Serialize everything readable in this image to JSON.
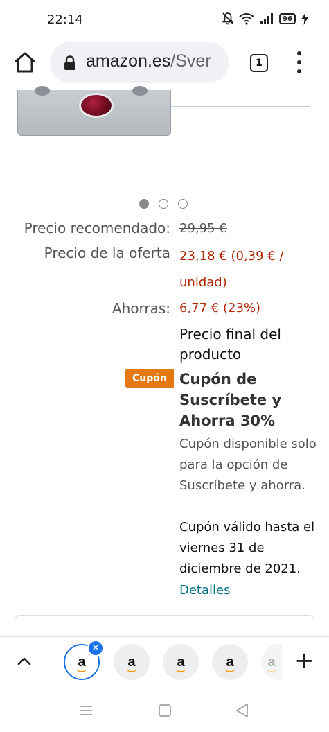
{
  "status_bar": {
    "time": "22:14",
    "battery": "96"
  },
  "browser": {
    "url_domain": "amazon.es",
    "url_path": "/Sver",
    "tab_count": "1"
  },
  "carousel": {
    "total": 3,
    "active_index": 0
  },
  "pricing": {
    "recommended_label": "Precio recomendado:",
    "recommended_value": "29,95 €",
    "offer_label": "Precio de la oferta",
    "offer_value_line1": "23,18 € (0,39 € /",
    "offer_value_line2": "unidad)",
    "savings_label": "Ahorras:",
    "savings_value": "6,77 € (23%)",
    "final_note": "Precio final del producto"
  },
  "coupon": {
    "badge": "Cupón",
    "title": "Cupón de Suscríbete y Ahorra 30%",
    "description": "Cupón disponible solo para la opción de Suscríbete y ahorra.",
    "validity": "Cupón válido hasta el viernes 31 de diciembre de 2021.",
    "details_link": "Detalles"
  },
  "tab_strip": {
    "tab_icon_label": "a"
  },
  "colors": {
    "price_red": "#b12704",
    "link_teal": "#007185",
    "coupon_orange": "#e47911",
    "active_tab_blue": "#1a73e8"
  }
}
